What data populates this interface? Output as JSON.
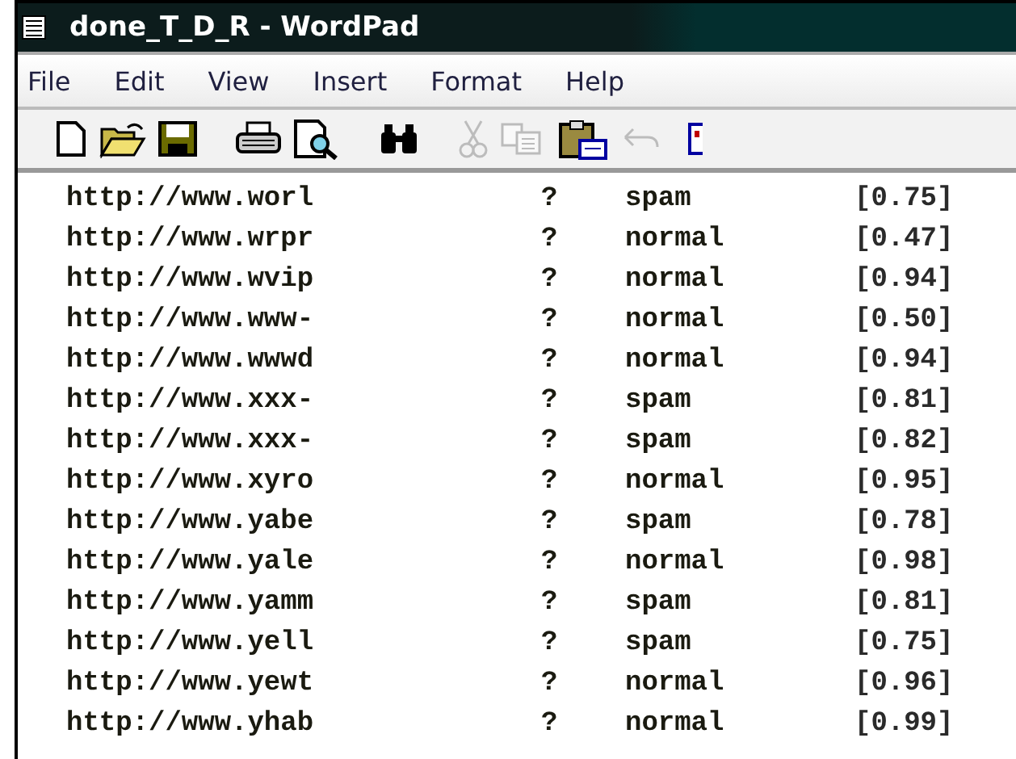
{
  "window": {
    "title": "done_T_D_R - WordPad"
  },
  "menu": [
    "File",
    "Edit",
    "View",
    "Insert",
    "Format",
    "Help"
  ],
  "toolbar": [
    {
      "kind": "new",
      "disabled": false
    },
    {
      "kind": "open",
      "disabled": false
    },
    {
      "kind": "save",
      "disabled": false
    },
    {
      "kind": "print",
      "disabled": false
    },
    {
      "kind": "preview",
      "disabled": false
    },
    {
      "kind": "find",
      "disabled": false
    },
    {
      "kind": "cut",
      "disabled": true
    },
    {
      "kind": "copy",
      "disabled": true
    },
    {
      "kind": "paste",
      "disabled": false
    },
    {
      "kind": "undo",
      "disabled": true
    },
    {
      "kind": "date",
      "disabled": false
    }
  ],
  "rows": [
    {
      "url": "http://www.worl",
      "mark": "?",
      "label": "spam",
      "score": "[0.75]"
    },
    {
      "url": "http://www.wrpr",
      "mark": "?",
      "label": "normal",
      "score": "[0.47]"
    },
    {
      "url": "http://www.wvip",
      "mark": "?",
      "label": "normal",
      "score": "[0.94]"
    },
    {
      "url": "http://www.www-",
      "mark": "?",
      "label": "normal",
      "score": "[0.50]"
    },
    {
      "url": "http://www.wwwd",
      "mark": "?",
      "label": "normal",
      "score": "[0.94]"
    },
    {
      "url": "http://www.xxx-",
      "mark": "?",
      "label": "spam",
      "score": "[0.81]"
    },
    {
      "url": "http://www.xxx-",
      "mark": "?",
      "label": "spam",
      "score": "[0.82]"
    },
    {
      "url": "http://www.xyro",
      "mark": "?",
      "label": "normal",
      "score": "[0.95]"
    },
    {
      "url": "http://www.yabe",
      "mark": "?",
      "label": "spam",
      "score": "[0.78]"
    },
    {
      "url": "http://www.yale",
      "mark": "?",
      "label": "normal",
      "score": "[0.98]"
    },
    {
      "url": "http://www.yamm",
      "mark": "?",
      "label": "spam",
      "score": "[0.81]"
    },
    {
      "url": "http://www.yell",
      "mark": "?",
      "label": "spam",
      "score": "[0.75]"
    },
    {
      "url": "http://www.yewt",
      "mark": "?",
      "label": "normal",
      "score": "[0.96]"
    },
    {
      "url": "http://www.yhab",
      "mark": "?",
      "label": "normal",
      "score": "[0.99]"
    }
  ]
}
